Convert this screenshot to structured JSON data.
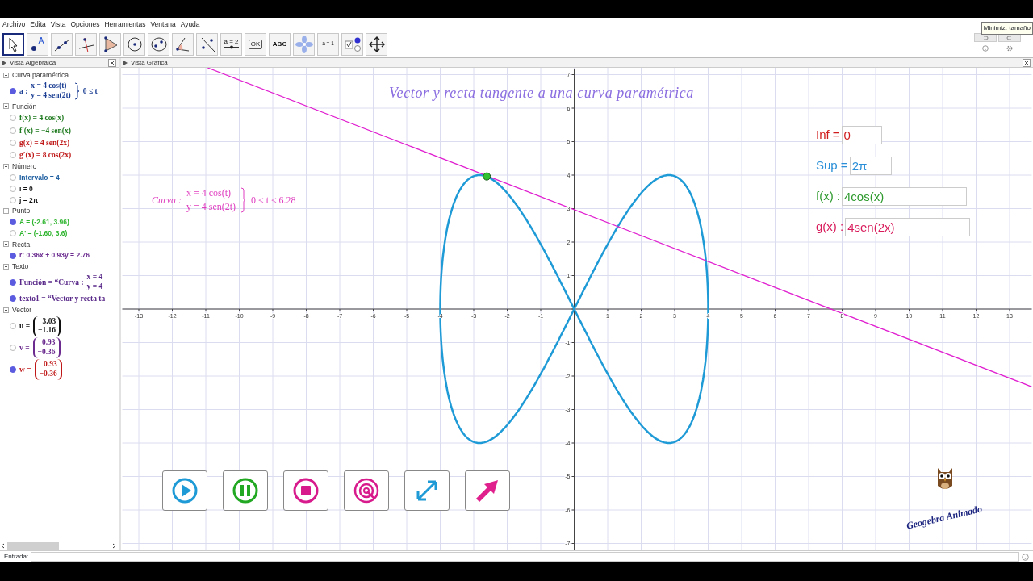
{
  "menu": [
    "Archivo",
    "Edita",
    "Vista",
    "Opciones",
    "Herramientas",
    "Ventana",
    "Ayuda"
  ],
  "toolbar": [
    {
      "kind": "select",
      "selected": true
    },
    {
      "kind": "point",
      "selected": false
    },
    {
      "kind": "line",
      "selected": false
    },
    {
      "kind": "perpendicular",
      "selected": false
    },
    {
      "kind": "polygon",
      "selected": false
    },
    {
      "kind": "circle",
      "selected": false
    },
    {
      "kind": "conic",
      "selected": false
    },
    {
      "kind": "angle",
      "selected": false
    },
    {
      "kind": "reflect",
      "selected": false
    },
    {
      "kind": "slider",
      "label": "a = 2",
      "selected": false
    },
    {
      "kind": "button",
      "label": "OK",
      "selected": false
    },
    {
      "kind": "text",
      "label": "ABC",
      "selected": false
    },
    {
      "kind": "image",
      "selected": false
    },
    {
      "kind": "inputbox",
      "label": "a = 1",
      "selected": false
    },
    {
      "kind": "checkbox",
      "selected": false
    },
    {
      "kind": "move",
      "selected": false
    }
  ],
  "tooltip": "Minimiz. tamaño",
  "algebra_view": {
    "title": "Vista Algebraica",
    "categories": [
      {
        "name": "Curva paramétrica",
        "items": [
          {
            "kind": "matrix",
            "visible": true,
            "color": "#1c3f94",
            "label": "a :",
            "lines": [
              "x = 4 cos(t)",
              "y = 4 sen(2t)"
            ],
            "suffix": "0 ≤ t"
          }
        ]
      },
      {
        "name": "Función",
        "items": [
          {
            "kind": "formula",
            "visible": false,
            "color": "#1f7a1f",
            "text": "f(x) = 4 cos(x)"
          },
          {
            "kind": "formula",
            "visible": false,
            "color": "#1f7a1f",
            "text": "f′(x) = −4 sen(x)"
          },
          {
            "kind": "formula",
            "visible": false,
            "color": "#c01818",
            "text": "g(x) = 4 sen(2x)"
          },
          {
            "kind": "formula",
            "visible": false,
            "color": "#c01818",
            "text": "g′(x) = 8 cos(2x)"
          }
        ]
      },
      {
        "name": "Número",
        "items": [
          {
            "kind": "plain",
            "visible": false,
            "color": "#1f5fa0",
            "text": "Intervalo = 4"
          },
          {
            "kind": "plain",
            "visible": false,
            "color": "#111111",
            "text": "i = 0"
          },
          {
            "kind": "plain",
            "visible": false,
            "color": "#111111",
            "text": "j = 2π"
          }
        ]
      },
      {
        "name": "Punto",
        "items": [
          {
            "kind": "plain",
            "visible": true,
            "color": "#2fb52f",
            "text": "A = (-2.61, 3.96)"
          },
          {
            "kind": "plain",
            "visible": false,
            "color": "#2fb52f",
            "text": "A' = (-1.60, 3.6)"
          }
        ]
      },
      {
        "name": "Recta",
        "items": [
          {
            "kind": "plain",
            "visible": true,
            "color": "#6b2b8f",
            "text": "r: 0.36x + 0.93y = 2.76"
          }
        ]
      },
      {
        "name": "Texto",
        "items": [
          {
            "kind": "matrix",
            "visible": true,
            "color": "#5a2a8a",
            "label": "Función = “Curva :",
            "lines": [
              "x = 4",
              "y = 4"
            ]
          },
          {
            "kind": "formula",
            "visible": true,
            "color": "#5a2a8a",
            "text": "texto1 = “Vector y recta ta"
          }
        ]
      },
      {
        "name": "Vector",
        "items": [
          {
            "kind": "vector",
            "visible": false,
            "color": "#111111",
            "label": "u =",
            "lines": [
              "3.03",
              "−1.16"
            ]
          },
          {
            "kind": "vector",
            "visible": false,
            "color": "#6b2b8f",
            "label": "v =",
            "lines": [
              "0.93",
              "−0.36"
            ]
          },
          {
            "kind": "vector",
            "visible": true,
            "color": "#c01818",
            "label": "w =",
            "lines": [
              "0.93",
              "−0.36"
            ]
          }
        ]
      }
    ]
  },
  "graphics_view": {
    "title": "Vista Gráfica",
    "x_tick_labels": [
      "-13",
      "-12",
      "-11",
      "-10",
      "-9",
      "-8",
      "-7",
      "-6",
      "-5",
      "-4",
      "-3",
      "-2",
      "-1",
      "1",
      "2",
      "3",
      "4",
      "5",
      "6",
      "7",
      "8",
      "9",
      "10",
      "11",
      "12",
      "13"
    ],
    "y_tick_labels": [
      "7",
      "6",
      "5",
      "4",
      "3",
      "2",
      "1",
      "-1",
      "-2",
      "-3",
      "-4",
      "-5",
      "-6",
      "-7"
    ],
    "heading": "Vector y recta tangente a una curva paramétrica",
    "curve_text": {
      "label": "Curva :",
      "lines": [
        "x = 4 cos(t)",
        "y = 4 sen(2t)"
      ],
      "suffix": "0 ≤ t ≤ 6.28"
    },
    "inputs": [
      {
        "label": "Inf =",
        "value": "0",
        "color": "#d01c1c"
      },
      {
        "label": "Sup =",
        "value": "2π",
        "color": "#2a8fd8"
      },
      {
        "label": "f(x) :",
        "value": "4cos(x)",
        "color": "#2e9a2e"
      },
      {
        "label": "g(x) :",
        "value": "4sen(2x)",
        "color": "#d81b5a"
      }
    ],
    "buttons": [
      {
        "kind": "play",
        "color": "#1e9ad6"
      },
      {
        "kind": "pause",
        "color": "#22a822"
      },
      {
        "kind": "stop",
        "color": "#d81b8c"
      },
      {
        "kind": "target",
        "color": "#d81b8c"
      },
      {
        "kind": "resize",
        "color": "#1e9ad6"
      },
      {
        "kind": "arrow",
        "color": "#e0208c"
      }
    ],
    "logo": "Geogebra Animado"
  },
  "input_bar": {
    "label": "Entrada:"
  }
}
